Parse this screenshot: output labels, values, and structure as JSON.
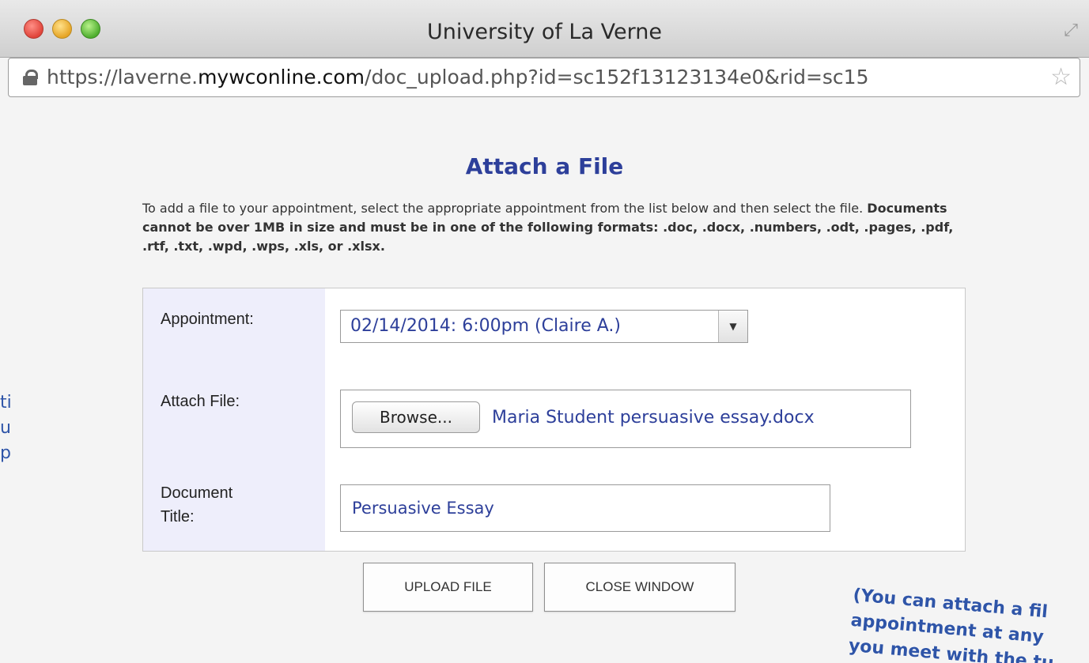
{
  "window": {
    "title": "University of La Verne",
    "url_prefix": "https://laverne.",
    "url_domain": "mywconline.com",
    "url_path": "/doc_upload.php?id=sc152f13123134e0&rid=sc15"
  },
  "page": {
    "heading": "Attach a File",
    "intro_plain": "To add a file to your appointment, select the appropriate appointment from the list below and then select the file.",
    "intro_bold": "Documents cannot be over 1MB in size and must be in one of the following formats: .doc, .docx, .numbers, .odt, .pages, .pdf, .rtf, .txt, .wpd, .wps, .xls, or .xlsx."
  },
  "form": {
    "appointment_label": "Appointment:",
    "appointment_value": "02/14/2014: 6:00pm (Claire A.)",
    "attach_label": "Attach File:",
    "browse_label": "Browse...",
    "file_name": "Maria Student persuasive essay.docx",
    "doc_title_label_line1": "Document",
    "doc_title_label_line2": "Title:",
    "doc_title_value": "Persuasive Essay"
  },
  "buttons": {
    "upload": "UPLOAD FILE",
    "close": "CLOSE WINDOW"
  },
  "annotation": {
    "line1": "(You can attach a fil",
    "line2": "appointment at any",
    "line3": "you meet with the tu"
  },
  "background_fragments": {
    "line1": "ti",
    "line2": "u",
    "line3": "p"
  },
  "icons": {
    "lock": "lock-icon",
    "star": "star-icon",
    "resize": "fullscreen-icon",
    "dropdown": "chevron-down-icon"
  }
}
